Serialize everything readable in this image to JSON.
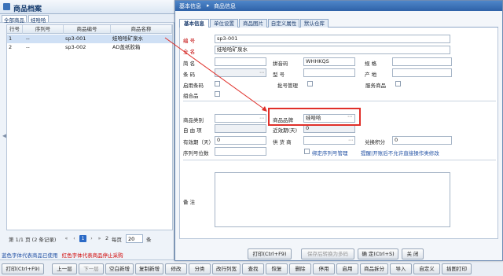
{
  "left_app": {
    "title": "商品档案",
    "tabs": [
      "全部商品",
      "娃哈哈"
    ],
    "grid": {
      "headers": [
        "行号",
        "序列号",
        "商品编号",
        "商品名称"
      ],
      "rows": [
        {
          "line": "1",
          "serial": "--",
          "code": "sp3-001",
          "name": "娃哈哈矿泉水",
          "selected": true
        },
        {
          "line": "2",
          "serial": "--",
          "code": "sp3-002",
          "name": "AD盖纸胶箱",
          "selected": false
        }
      ]
    },
    "pager": {
      "page_text": "第 1/1 页 (2 条记录)",
      "first": "«",
      "prev": "‹",
      "current": "1",
      "next": "›",
      "last": "»",
      "page_count_label": "2",
      "per_page_label": "每页",
      "per_page_value": "20",
      "unit": "条"
    },
    "legend": {
      "blue": "蓝色字体代表商品已使用",
      "red": "红色字体代表商品停止采购"
    }
  },
  "toolbar": {
    "buttons": [
      "打印(Ctrl+F9)",
      "上一层",
      "下一层",
      "空白新增",
      "复制新增",
      "修改",
      "分类",
      "改行列宽",
      "查找",
      "恢复",
      "删除",
      "停用",
      "启用",
      "商品拆分",
      "导入",
      "自定义",
      "插图打印"
    ]
  },
  "dialog": {
    "breadcrumb": [
      "基本信息",
      "商品信息"
    ],
    "tabs": [
      "基本信息",
      "单位设置",
      "商品图片",
      "自定义属性",
      "默认仓库"
    ],
    "fields": {
      "code_label": "编 号",
      "code_value": "sp3-001",
      "fullname_label": "全 名",
      "fullname_value": "娃哈哈矿泉水",
      "shortname_label": "简 名",
      "pinyin_label": "拼音码",
      "pinyin_value": "WHHKQS",
      "spec_label": "规 格",
      "barcode_label": "条 码",
      "model_label": "型 号",
      "origin_label": "产 地",
      "enable_barcode_label": "启用条码",
      "batch_label": "批号管理",
      "service_label": "服务商品",
      "combo_label": "组合品",
      "category_label": "商品类别",
      "brand_label": "商品品牌",
      "brand_value": "娃哈哈",
      "free_label": "自 由 项",
      "recent_days_label": "近效期(天)",
      "recent_days_value": "0",
      "expiry_label": "有效期（天）",
      "expiry_value": "0",
      "supplier_label": "供 货 商",
      "points_label": "兑换积分",
      "points_value": "0",
      "serial_digits_label": "序列号位数",
      "bind_serial_label": "绑定序列号管理",
      "warning_link": "提醒|开账后不允许直接操作类修改",
      "remark_label": "备 注"
    },
    "footer": {
      "print": "打印(Ctrl+F9)",
      "save_new": "保存后转换为多码",
      "confirm": "确 定(Ctrl+S)",
      "close": "关 闭"
    }
  },
  "colors": {
    "accent": "#2f62a8",
    "highlight": "#e0302a",
    "link": "#1f4fa3",
    "required": "#c00000"
  }
}
